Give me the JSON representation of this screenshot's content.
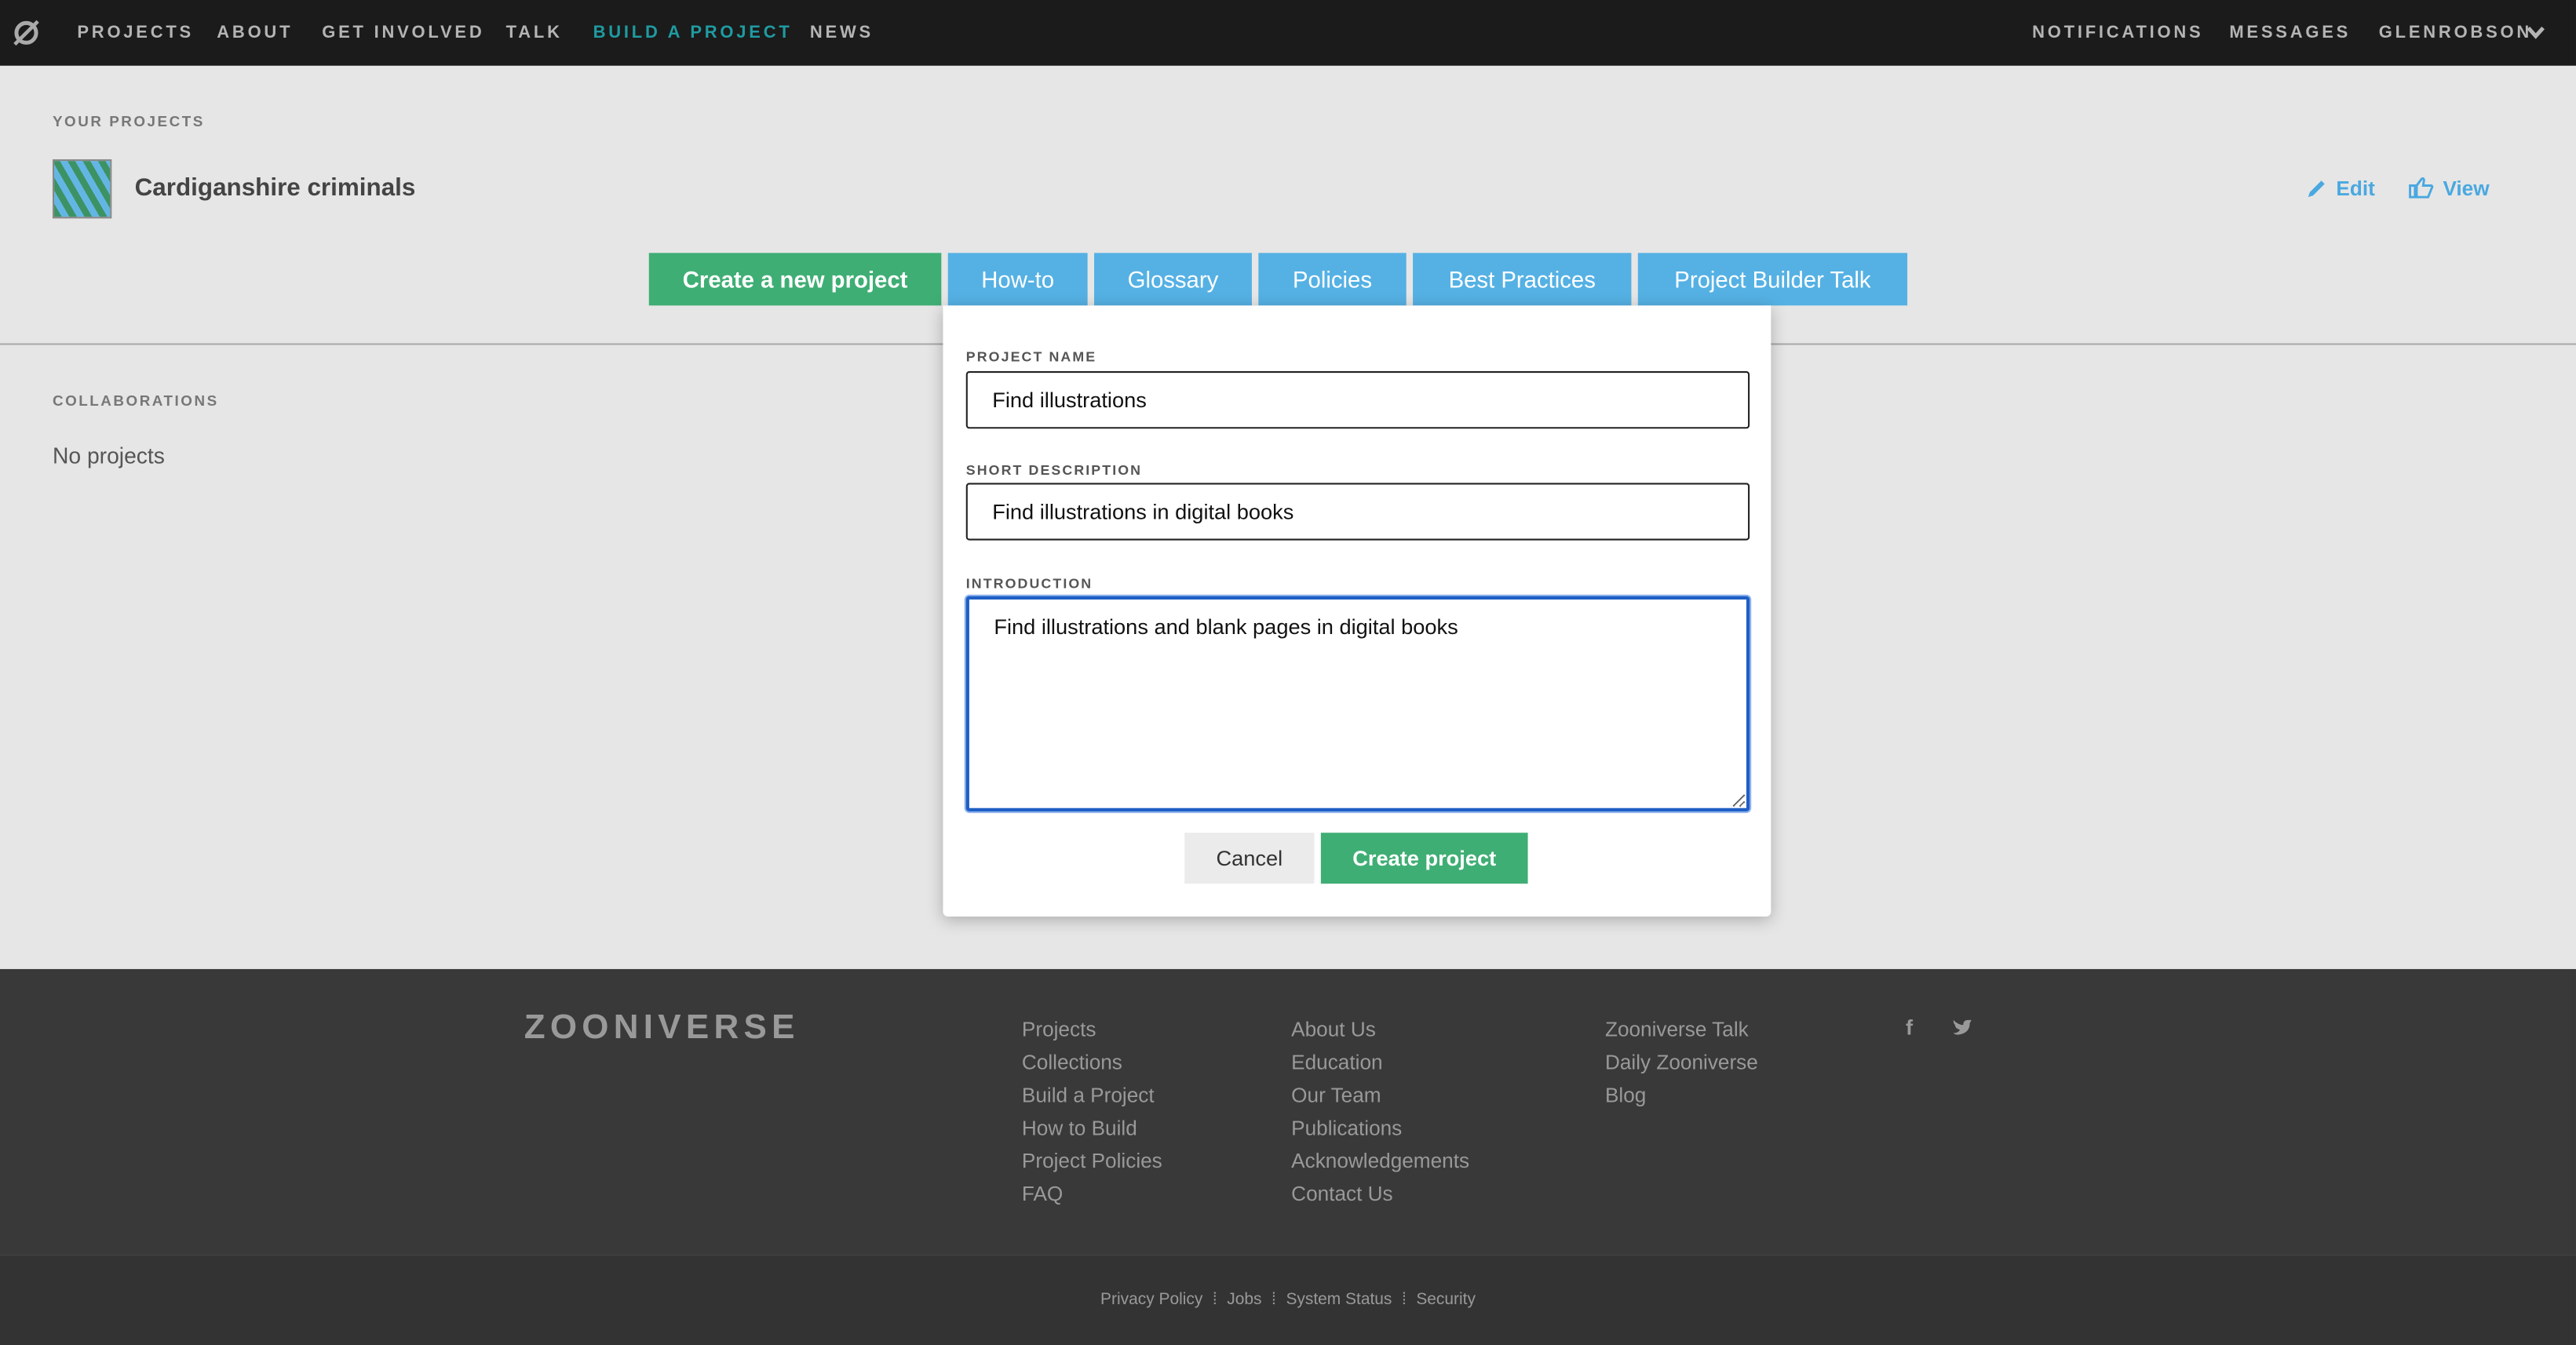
{
  "nav": {
    "left": [
      "PROJECTS",
      "ABOUT",
      "GET INVOLVED",
      "TALK",
      "BUILD A PROJECT",
      "NEWS"
    ],
    "active": "BUILD A PROJECT",
    "right": [
      "NOTIFICATIONS",
      "MESSAGES",
      "GLENROBSON"
    ],
    "logo_icon": "zooniverse-logo-icon",
    "accent_color": "#1f9ba1"
  },
  "your_projects": {
    "heading": "YOUR PROJECTS",
    "project_title": "Cardiganshire criminals",
    "edit_label": "Edit",
    "view_label": "View",
    "link_color": "#4aa8e0"
  },
  "tabs": [
    "Create a new project",
    "How-to",
    "Glossary",
    "Policies",
    "Best Practices",
    "Project Builder Talk"
  ],
  "collaborations": {
    "heading": "COLLABORATIONS",
    "empty": "No projects"
  },
  "form": {
    "name_label": "PROJECT NAME",
    "name_value": "Find illustrations",
    "desc_label": "SHORT DESCRIPTION",
    "desc_value": "Find illustrations in digital books",
    "intro_label": "INTRODUCTION",
    "intro_value": "Find illustrations and blank pages in digital books",
    "cancel": "Cancel",
    "create": "Create project",
    "green": "#3fae74"
  },
  "footer": {
    "logo": "ZOONIVERSE",
    "col1": [
      "Projects",
      "Collections",
      "Build a Project",
      "How to Build",
      "Project Policies",
      "FAQ"
    ],
    "col2": [
      "About Us",
      "Education",
      "Our Team",
      "Publications",
      "Acknowledgements",
      "Contact Us"
    ],
    "col3": [
      "Zooniverse Talk",
      "Daily Zooniverse",
      "Blog"
    ],
    "social": [
      "facebook-icon",
      "twitter-icon"
    ],
    "bottom": [
      "Privacy Policy",
      "Jobs",
      "System Status",
      "Security"
    ]
  }
}
